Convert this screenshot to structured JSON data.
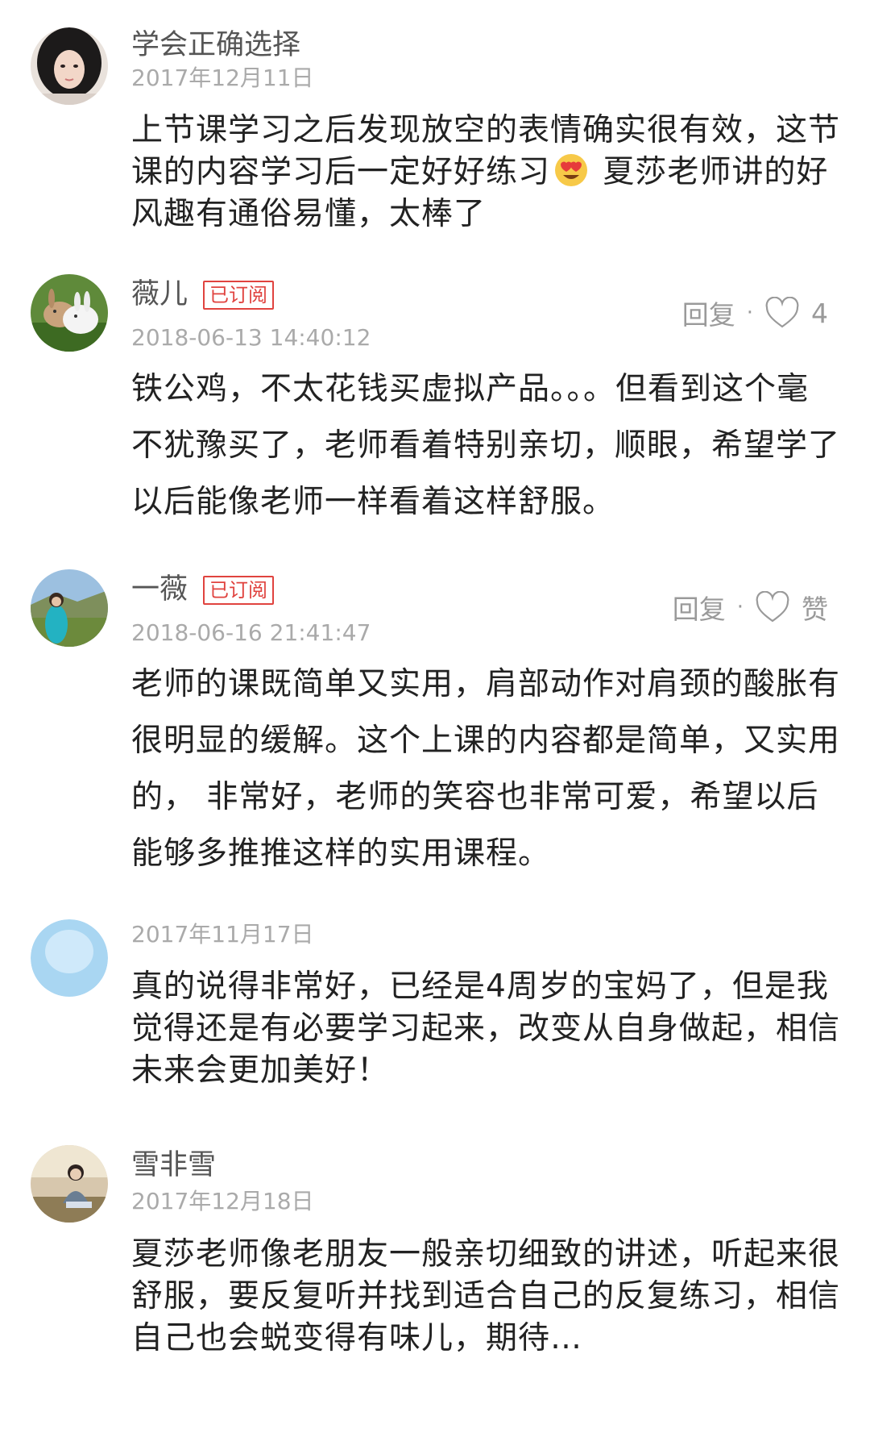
{
  "comments": [
    {
      "name": "学会正确选择",
      "time": "2017年12月11日",
      "text_before": "上节课学习之后发现放空的表情确实很有效，这节课的内容学习后一定好好练习",
      "emoji": "heart-eyes-emoji",
      "text_after": " 夏莎老师讲的好风趣有通俗易懂，太棒了"
    },
    {
      "name": "薇儿",
      "badge": "已订阅",
      "time": "2018-06-13 14:40:12",
      "reply_label": "回复",
      "like_count": "4",
      "text": "铁公鸡，不太花钱买虚拟产品。。。但看到这个毫不犹豫买了，老师看着特别亲切，顺眼，希望学了以后能像老师一样看着这样舒服。"
    },
    {
      "name": "一薇",
      "badge": "已订阅",
      "time": "2018-06-16 21:41:47",
      "reply_label": "回复",
      "like_count": "赞",
      "text": "老师的课既简单又实用，肩部动作对肩颈的酸胀有很明显的缓解。这个上课的内容都是简单，又实用的， 非常好，老师的笑容也非常可爱，希望以后能够多推推这样的实用课程。"
    },
    {
      "time": "2017年11月17日",
      "text": "真的说得非常好，已经是4周岁的宝妈了，但是我觉得还是有必要学习起来，改变从自身做起，相信未来会更加美好！"
    },
    {
      "name": "雪非雪",
      "time": "2017年12月18日",
      "text": "夏莎老师像老朋友一般亲切细致的讲述，听起来很舒服，要反复听并找到适合自己的反复练习，相信自己也会蜕变得有味儿，期待…"
    }
  ],
  "separator_dot": "·",
  "icons": {
    "like": "heart-outline-icon",
    "avatar_placeholder": "default-avatar-icon"
  },
  "colors": {
    "badge": "#e0433f",
    "meta": "#aaaaaa",
    "text": "#222222"
  }
}
